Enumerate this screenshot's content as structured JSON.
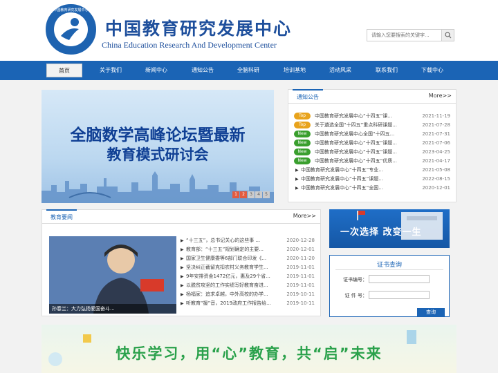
{
  "header": {
    "logo_ring_text": "中国教育研究发展中心",
    "brand_cn": "中国教育研究发展中心",
    "brand_en": "China Education Research And Development Center",
    "search_placeholder": "请输入您要搜索的关键字..."
  },
  "nav": {
    "items": [
      "首页",
      "关于我们",
      "新闻中心",
      "通知公告",
      "全脑科研",
      "培训基地",
      "活动风采",
      "联系我们",
      "下载中心"
    ],
    "active": "首页"
  },
  "banner": {
    "line1": "全脑数学高峰论坛暨最新",
    "line2": "教育模式研讨会",
    "pages": [
      "1",
      "2",
      "3",
      "4",
      "5"
    ]
  },
  "notice": {
    "tab": "通知公告",
    "more": "More>>",
    "rows": [
      {
        "badge": "Top",
        "title": "中国教育研究发展中心“十四五”课...",
        "date": "2021-11-19"
      },
      {
        "badge": "Top",
        "title": "关于遴选全国“十四五”重点科研课题...",
        "date": "2021-07-28"
      },
      {
        "badge": "New",
        "title": "中国教育研究发展中心全国“十四五...",
        "date": "2021-07-31"
      },
      {
        "badge": "New",
        "title": "中国教育研究发展中心“十四五”课题...",
        "date": "2021-07-06"
      },
      {
        "badge": "New",
        "title": "中国教育研究发展中心“十四五”课题...",
        "date": "2023-04-25"
      },
      {
        "badge": "New",
        "title": "中国教育研究发展中心“十四五”优质...",
        "date": "2021-04-17"
      },
      {
        "badge": "",
        "title": "中国教育研究发展中心“十四五”专业...",
        "date": "2021-05-08"
      },
      {
        "badge": "",
        "title": "中国教育研究发展中心“十四五”课题...",
        "date": "2022-08-15"
      },
      {
        "badge": "",
        "title": "中国教育研究发展中心“十四五”全国...",
        "date": "2020-12-01"
      }
    ]
  },
  "news": {
    "tab": "教育要闻",
    "more": "More>>",
    "photo_caption": "孙春兰：大力弘扬爱国奋斗...",
    "rows": [
      {
        "title": "“十三五”，总书记关心的这些事 ...",
        "date": "2020-12-28"
      },
      {
        "title": "教育部：“十三五”规划确定的主要...",
        "date": "2020-12-01"
      },
      {
        "title": "国家卫生健康委等6部门联合印发《...",
        "date": "2020-11-20"
      },
      {
        "title": "坚决纠正截留克扣农村义务教育学生...",
        "date": "2019-11-01"
      },
      {
        "title": "9年安排资金1472亿元，惠及29个省...",
        "date": "2019-11-01"
      },
      {
        "title": "以脱贫攻坚的工作实绩写好教育奋进...",
        "date": "2019-11-01"
      },
      {
        "title": "杨福家：追求卓越，中外高校的办学...",
        "date": "2019-10-11"
      },
      {
        "title": "听教育“援”音，2019政府工作报告给...",
        "date": "2019-10-11"
      }
    ]
  },
  "promo": {
    "text": "一次选择 改变一生"
  },
  "cert": {
    "title": "证书查询",
    "number_label": "证书编号：",
    "name_label": "证 件 号：",
    "button": "查询"
  },
  "footer_banner": {
    "text": "快乐学习，用“心”教育，共“启”未来"
  }
}
